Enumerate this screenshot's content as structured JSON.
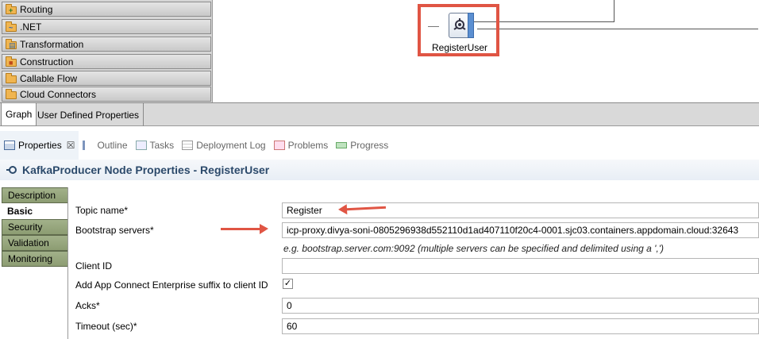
{
  "palette": {
    "drawers": [
      {
        "label": "Routing",
        "icon": "routing-folder-icon"
      },
      {
        "label": ".NET",
        "icon": "dotnet-folder-icon"
      },
      {
        "label": "Transformation",
        "icon": "transformation-folder-icon"
      },
      {
        "label": "Construction",
        "icon": "construction-folder-icon"
      },
      {
        "label": "Callable Flow",
        "icon": "callable-flow-folder-icon"
      },
      {
        "label": "Cloud Connectors",
        "icon": "cloud-connectors-folder-icon"
      }
    ]
  },
  "canvas": {
    "node_label": "RegisterUser",
    "highlight_color": "#e05544"
  },
  "graph_tabs": [
    {
      "label": "Graph"
    },
    {
      "label": "User Defined Properties"
    }
  ],
  "views": {
    "tabs": [
      {
        "label": "Properties",
        "icon": "properties-icon"
      },
      {
        "label": "Outline",
        "icon": "outline-icon"
      },
      {
        "label": "Tasks",
        "icon": "tasks-icon"
      },
      {
        "label": "Deployment Log",
        "icon": "deployment-log-icon"
      },
      {
        "label": "Problems",
        "icon": "problems-icon"
      },
      {
        "label": "Progress",
        "icon": "progress-icon"
      }
    ],
    "close_glyph": "☒"
  },
  "properties": {
    "title": "KafkaProducer Node Properties - RegisterUser",
    "tabs": [
      {
        "label": "Description"
      },
      {
        "label": "Basic"
      },
      {
        "label": "Security"
      },
      {
        "label": "Validation"
      },
      {
        "label": "Monitoring"
      }
    ],
    "fields": {
      "topic_label": "Topic name*",
      "topic_value": "Register",
      "bootstrap_label": "Bootstrap servers*",
      "bootstrap_value": "icp-proxy.divya-soni-0805296938d552110d1ad407110f20c4-0001.sjc03.containers.appdomain.cloud:32643",
      "bootstrap_hint": "e.g. bootstrap.server.com:9092 (multiple servers can be specified and delimited using a ',')",
      "client_id_label": "Client ID",
      "client_id_value": "",
      "suffix_label": "Add App Connect Enterprise suffix to client ID",
      "suffix_checked": "✓",
      "acks_label": "Acks*",
      "acks_value": "0",
      "timeout_label": "Timeout (sec)*",
      "timeout_value": "60"
    }
  }
}
